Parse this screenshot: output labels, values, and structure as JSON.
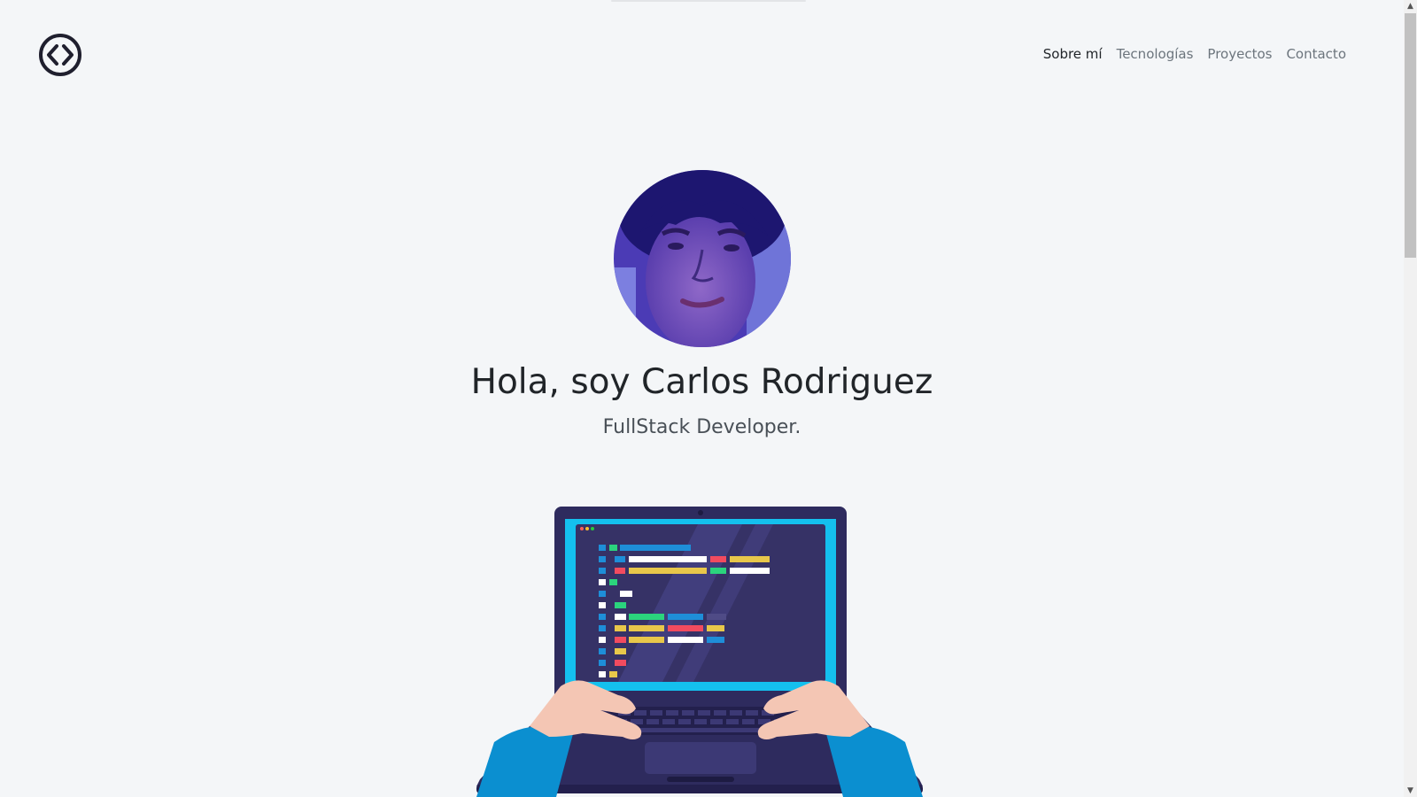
{
  "brand": {
    "logo_icon": "code-brackets-icon"
  },
  "nav": {
    "items": [
      {
        "label": "Sobre mí",
        "active": true
      },
      {
        "label": "Tecnologías",
        "active": false
      },
      {
        "label": "Proyectos",
        "active": false
      },
      {
        "label": "Contacto",
        "active": false
      }
    ]
  },
  "hero": {
    "title": "Hola, soy Carlos Rodriguez",
    "subtitle": "FullStack Developer.",
    "avatar_icon": "profile-photo",
    "illustration_icon": "laptop-coding-illustration"
  },
  "colors": {
    "background": "#f4f6f8",
    "text_dark": "#212529",
    "nav_muted": "#6c757d",
    "laptop_body": "#2e2b5e",
    "screen_border": "#14c0ee",
    "sleeve": "#0b8fd0",
    "skin": "#f4c6b4"
  }
}
